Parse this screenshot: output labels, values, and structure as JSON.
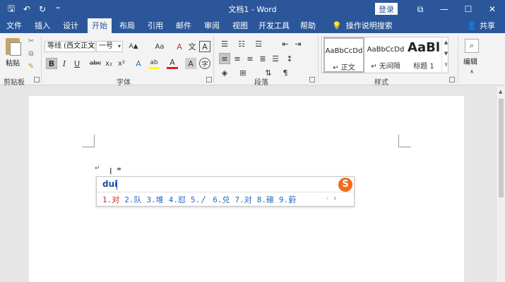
{
  "window": {
    "title": "文档1 - Word",
    "login_label": "登录",
    "qat": {
      "save": "🖫",
      "undo": "↶",
      "redo": "↻",
      "customize": "⁼"
    },
    "controls": {
      "ribbon_display": "⧉",
      "minimize": "—",
      "maximize": "☐",
      "close": "✕"
    }
  },
  "tabs": [
    {
      "label": "文件"
    },
    {
      "label": "插入"
    },
    {
      "label": "设计"
    },
    {
      "label": "开始"
    },
    {
      "label": "布局"
    },
    {
      "label": "引用"
    },
    {
      "label": "邮件"
    },
    {
      "label": "审阅"
    },
    {
      "label": "视图"
    },
    {
      "label": "开发工具"
    },
    {
      "label": "帮助"
    }
  ],
  "tellme": {
    "icon": "💡",
    "label": "操作说明搜索"
  },
  "share": {
    "icon": "👤",
    "label": "共享"
  },
  "ribbon": {
    "clipboard": {
      "paste_label": "粘贴",
      "group_label": "剪贴板"
    },
    "font": {
      "font_name": "等线 (西文正文)",
      "font_size": "一号",
      "grow": "A▲",
      "shrink": "A▼",
      "change_case": "Aa",
      "clear": "A",
      "phonetic": "文",
      "border": "A",
      "bold": "B",
      "italic": "I",
      "underline": "U",
      "strike": "abc",
      "subscript": "x₂",
      "superscript": "x²",
      "effects": "A",
      "highlight": "ab",
      "color": "A",
      "shade": "A",
      "enclose": "字",
      "group_label": "字体"
    },
    "paragraph": {
      "group_label": "段落"
    },
    "styles": {
      "items": [
        {
          "sample": "AaBbCcDd",
          "name": "↵ 正文"
        },
        {
          "sample": "AaBbCcDd",
          "name": "↵ 无间隔"
        },
        {
          "sample": "AaBl",
          "name": "标题 1"
        }
      ],
      "group_label": "样式"
    },
    "editing": {
      "label": "编辑"
    }
  },
  "document": {
    "paragraph_mark": "↵",
    "ime": {
      "composition": "dui",
      "candidates": [
        "1.对",
        "2.队",
        "3.堆",
        "4.怼",
        "5.〳",
        "6.兑",
        "7.对",
        "8.碓",
        "9.薱"
      ],
      "prev": "‹",
      "next": "›",
      "logo": "S"
    }
  },
  "colors": {
    "accent": "#2b579a",
    "ime_first": "#d21f1f",
    "ime_cand": "#1b6bbf",
    "sogou": "#f26b1d"
  }
}
